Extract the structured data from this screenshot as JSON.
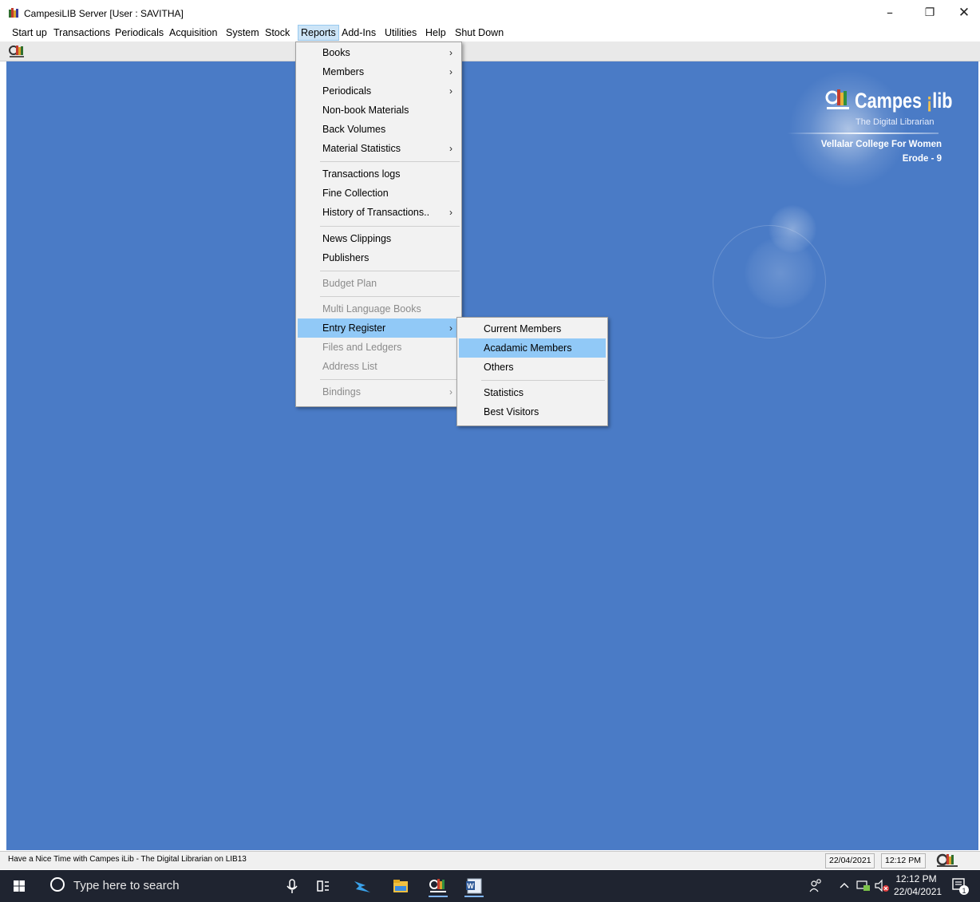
{
  "window": {
    "title": "CampesiLIB Server [User : SAVITHA]",
    "controls": {
      "minimize": "–",
      "maximize": "❐",
      "close": "✕"
    }
  },
  "menubar": {
    "items": [
      "Start up",
      "Transactions",
      "Periodicals",
      "Acquisition",
      "System",
      "Stock",
      "Reports",
      "Add-Ins",
      "Utilities",
      "Help",
      "Shut Down"
    ],
    "active": "Reports"
  },
  "reports_menu": {
    "items": [
      {
        "label": "Books",
        "arrow": "›",
        "enabled": true
      },
      {
        "label": "Members",
        "arrow": "›",
        "enabled": true
      },
      {
        "label": "Periodicals",
        "arrow": "›",
        "enabled": true
      },
      {
        "label": "Non-book Materials",
        "arrow": "",
        "enabled": true
      },
      {
        "label": "Back Volumes",
        "arrow": "",
        "enabled": true
      },
      {
        "label": "Material Statistics",
        "arrow": "›",
        "enabled": true
      },
      {
        "label": "Transactions logs",
        "arrow": "",
        "enabled": true
      },
      {
        "label": "Fine Collection",
        "arrow": "",
        "enabled": true
      },
      {
        "label": "History of Transactions..",
        "arrow": "›",
        "enabled": true
      },
      {
        "label": "News Clippings",
        "arrow": "",
        "enabled": true
      },
      {
        "label": "Publishers",
        "arrow": "",
        "enabled": true
      },
      {
        "label": "Budget Plan",
        "arrow": "",
        "enabled": false
      },
      {
        "label": "Multi Language Books",
        "arrow": "",
        "enabled": false
      },
      {
        "label": "Entry Register",
        "arrow": "›",
        "enabled": true,
        "highlighted": true
      },
      {
        "label": "Files and Ledgers",
        "arrow": "",
        "enabled": false
      },
      {
        "label": "Address List",
        "arrow": "",
        "enabled": false
      },
      {
        "label": "Bindings",
        "arrow": "›",
        "enabled": false
      }
    ]
  },
  "entry_register_submenu": {
    "items": [
      {
        "label": "Current Members"
      },
      {
        "label": "Acadamic Members",
        "highlighted": true
      },
      {
        "label": "Others"
      },
      {
        "label": "Statistics"
      },
      {
        "label": "Best Visitors"
      }
    ]
  },
  "branding": {
    "name": "Campes",
    "name_suffix": "lib",
    "tagline": "The Digital Librarian",
    "college": "Vellalar College For Women",
    "city": "Erode - 9"
  },
  "statusbar": {
    "message": "Have a Nice Time with Campes iLib - The Digital Librarian on LIB13",
    "date": "22/04/2021",
    "time": "12:12 PM"
  },
  "taskbar": {
    "search_placeholder": "Type here to search",
    "clock_time": "12:12 PM",
    "clock_date": "22/04/2021",
    "notification_count": "1"
  },
  "colors": {
    "desktop": "#4a7bc6",
    "menu_highlight": "#91c9f7",
    "menubar_active": "#cce4f7",
    "taskbar": "#1f2430"
  }
}
